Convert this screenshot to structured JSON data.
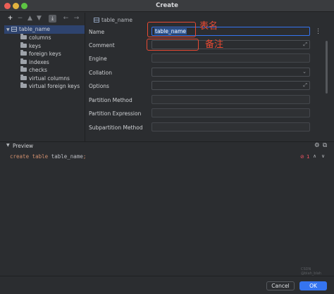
{
  "window": {
    "title": "Create"
  },
  "tree": {
    "toolbar_icons": [
      "plus-icon",
      "minus-icon",
      "up-arrow-icon",
      "down-arrow-icon",
      "jump-to-icon",
      "back-arrow-icon",
      "forward-arrow-icon"
    ],
    "root": "table_name",
    "children": [
      "columns",
      "keys",
      "foreign keys",
      "indexes",
      "checks",
      "virtual columns",
      "virtual foreign keys"
    ]
  },
  "form": {
    "tab": "table_name",
    "fields": {
      "name": {
        "label": "Name",
        "value": "table_name"
      },
      "comment": {
        "label": "Comment",
        "value": ""
      },
      "engine": {
        "label": "Engine",
        "value": ""
      },
      "collation": {
        "label": "Collation",
        "value": ""
      },
      "options": {
        "label": "Options",
        "value": ""
      },
      "partition_method": {
        "label": "Partition Method",
        "value": ""
      },
      "partition_expression": {
        "label": "Partition Expression",
        "value": ""
      },
      "subpartition_method": {
        "label": "Subpartition Method",
        "value": ""
      }
    }
  },
  "annotations": {
    "name_note": "表名",
    "comment_note": "备注",
    "color": "#e94a33"
  },
  "preview": {
    "title": "Preview",
    "code": {
      "kw1": "create",
      "kw2": "table",
      "ident": "table_name",
      "semi": ";"
    },
    "error_count": "1",
    "watermark": "CSDN @blah_blah"
  },
  "buttons": {
    "cancel": "Cancel",
    "ok": "OK"
  },
  "colors": {
    "accent": "#3574f0",
    "selection": "#2e436e",
    "keyword": "#cf8e6d",
    "error": "#f75464"
  }
}
